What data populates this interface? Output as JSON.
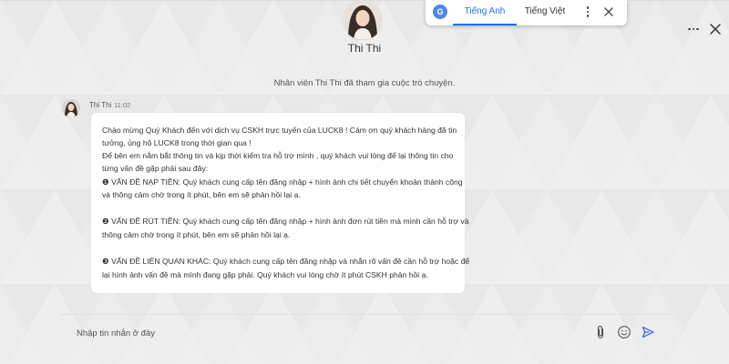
{
  "agent": {
    "name": "Thi Thi"
  },
  "translate": {
    "tabs": [
      {
        "label": "Tiếng Anh",
        "active": true
      },
      {
        "label": "Tiếng Việt",
        "active": false
      }
    ],
    "icon_text": "G"
  },
  "chat": {
    "system_message": "Nhân viên Thi Thi đã tham gia cuộc trò chuyện.",
    "message": {
      "sender": "Thi Thi",
      "time": "11:02",
      "lines": [
        "Chào mừng Quý Khách đến với dịch vụ CSKH trực tuyến của LUCK8 ! Cám ơn quý khách hàng đã tin",
        "tưởng, ủng hộ LUCK8 trong thời gian qua !",
        "Để bên em nắm bắt thông tin và kịp thời kiểm tra hỗ trợ mình , quý khách vui lòng để lại thông tin cho",
        "từng vấn đề gặp phải sau đây:",
        "❶ VẤN ĐỀ NẠP TIỀN: Quý khách cung cấp tên đăng nhập + hình ảnh chi tiết chuyển khoản thành công",
        "và thông cảm chờ trong ít phút, bên em sẽ phản hồi lại ạ.",
        "",
        "❷ VẤN ĐỀ RÚT TIỀN: Quý khách cung cấp tên đăng nhập + hình ảnh đơn rút tiền mà mình cần hỗ trợ và",
        "thông cảm chờ trong ít phút, bên em sẽ phản hồi lại ạ.",
        "",
        "❸ VẤN ĐỀ LIÊN QUAN KHÁC: Quý khách cung cấp tên đăng nhập và nhắn rõ vấn đề cần hỗ trợ hoặc để",
        "lại hình ảnh vấn đề mà mình đang gặp phải. Quý khách vui lòng chờ ít phút CSKH phản hồi ạ."
      ]
    }
  },
  "input": {
    "placeholder": "Nhập tin nhắn ở đây",
    "value": ""
  },
  "icons": {
    "avatar": "avatar-photo",
    "more": "more-horizontal-icon",
    "close": "close-icon",
    "translate": "google-translate-icon",
    "translate_more": "more-vertical-icon",
    "attach": "paperclip-icon",
    "emoji": "emoji-icon",
    "send": "send-icon"
  },
  "colors": {
    "accent": "#1a73e8",
    "background": "#ececed",
    "bubble": "#ffffff"
  }
}
